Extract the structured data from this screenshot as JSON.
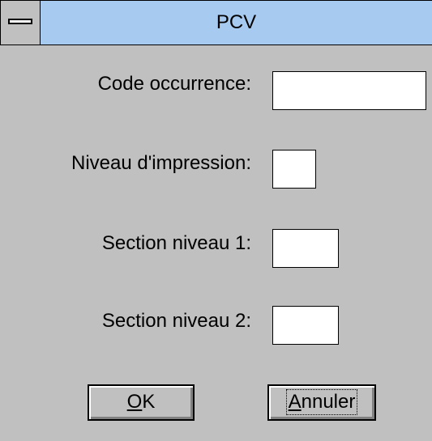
{
  "window": {
    "title": "PCV"
  },
  "form": {
    "code_occurrence_label": "Code occurrence:",
    "code_occurrence_value": "",
    "niveau_impression_label": "Niveau d'impression:",
    "niveau_impression_value": "",
    "section_niveau1_label": "Section niveau 1:",
    "section_niveau1_value": "",
    "section_niveau2_label": "Section niveau 2:",
    "section_niveau2_value": ""
  },
  "buttons": {
    "ok_mnemonic": "O",
    "ok_rest": "K",
    "cancel_mnemonic": "A",
    "cancel_rest": "nnuler"
  },
  "icons": {
    "system_menu": "system-menu-icon"
  },
  "colors": {
    "title_bar": "#a6caf0",
    "dialog_background": "#c0c0c0",
    "field_background": "#ffffff"
  }
}
